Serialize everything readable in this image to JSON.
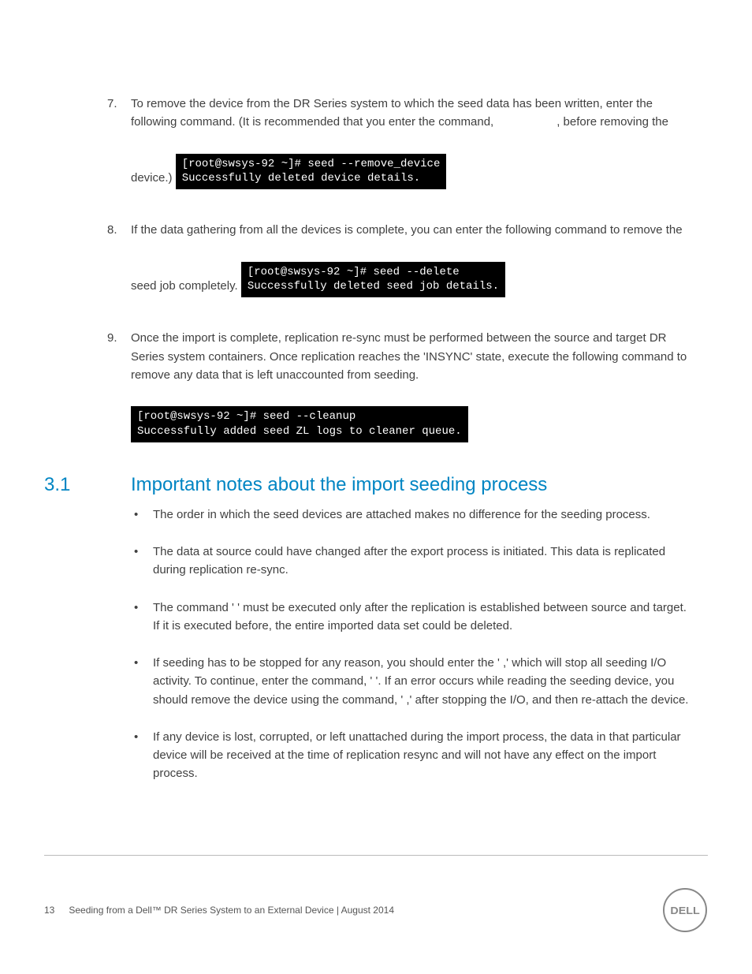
{
  "steps": [
    {
      "num": "7.",
      "text_a": "To remove the device from the DR Series system to which the seed data has been written, enter the following command. (It is recommended that you enter the command,",
      "text_b": ", before removing the device.)",
      "terminal": "[root@swsys-92 ~]# seed --remove_device\nSuccessfully deleted device details."
    },
    {
      "num": "8.",
      "text_a": "If the data gathering from all the devices is complete, you can enter the following command to remove the seed job completely.",
      "terminal": "[root@swsys-92 ~]# seed --delete\nSuccessfully deleted seed job details."
    },
    {
      "num": "9.",
      "text_a": "Once the import is complete, replication re-sync must be performed between the source and target DR Series system containers. Once replication reaches the 'INSYNC' state, execute the following command to remove any data that is left unaccounted from seeding.",
      "terminal": "[root@swsys-92 ~]# seed --cleanup\nSuccessfully added seed ZL logs to cleaner queue."
    }
  ],
  "section": {
    "num": "3.1",
    "title": "Important notes about the import seeding process"
  },
  "bullets": [
    "The order in which the seed devices are attached makes no difference for the seeding process.",
    "The data at source could have changed after the export process is initiated. This data is replicated during replication re-sync.",
    "The command '                          ' must be executed only after the replication is established between source and target. If it is executed before, the entire imported data set could be deleted.",
    "If seeding has to be stopped for any reason, you should enter the '                    ,' which will stop all seeding I/O activity. To continue, enter the command, '                      '. If an error occurs while reading the seeding device, you should remove the device using the command, '                                        ,' after stopping the I/O, and then re-attach the device.",
    "If any device is lost, corrupted, or left unattached during the import process, the data in that particular device will be received at the time of replication resync and will not have any effect on the import process."
  ],
  "footer": {
    "page_num": "13",
    "doc_title": "Seeding from a Dell™ DR Series System to an External Device | August 2014"
  }
}
